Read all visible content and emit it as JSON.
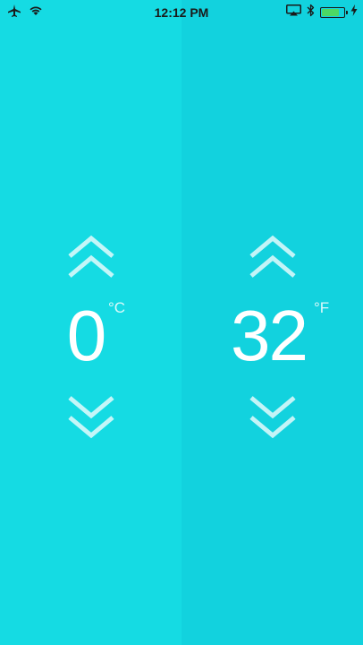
{
  "status_bar": {
    "time": "12:12 PM",
    "battery_level": 0.8,
    "battery_color": "#4cd964",
    "icons": [
      "airplane-mode-icon",
      "wifi-icon",
      "airplay-icon",
      "bluetooth-icon",
      "battery-icon",
      "charging-bolt-icon"
    ]
  },
  "colors": {
    "left_panel": "#15dbe3",
    "right_panel": "#12d2de",
    "text": "#ffffff"
  },
  "celsius": {
    "value": "0",
    "unit": "°C"
  },
  "fahrenheit": {
    "value": "32",
    "unit": "°F"
  }
}
